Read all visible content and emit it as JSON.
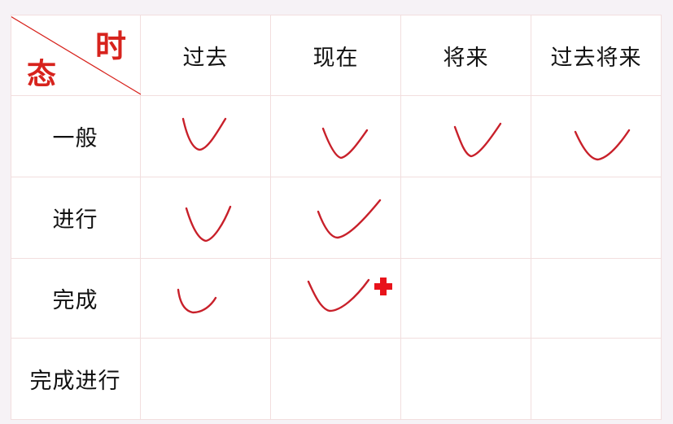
{
  "corner": {
    "time_label": "时",
    "aspect_label": "态"
  },
  "columns": [
    "过去",
    "现在",
    "将来",
    "过去将来"
  ],
  "rows": [
    {
      "label": "一般",
      "checked": [
        true,
        true,
        true,
        true
      ]
    },
    {
      "label": "进行",
      "checked": [
        true,
        true,
        false,
        false
      ]
    },
    {
      "label": "完成",
      "checked": [
        true,
        true,
        false,
        false
      ]
    },
    {
      "label": "完成进行",
      "checked": [
        false,
        false,
        false,
        false
      ]
    }
  ],
  "colors": {
    "accent": "#d7231d",
    "mark": "#c8202a",
    "grid": "#f2dede"
  },
  "cursor_icon": "red-plus-cursor-icon"
}
